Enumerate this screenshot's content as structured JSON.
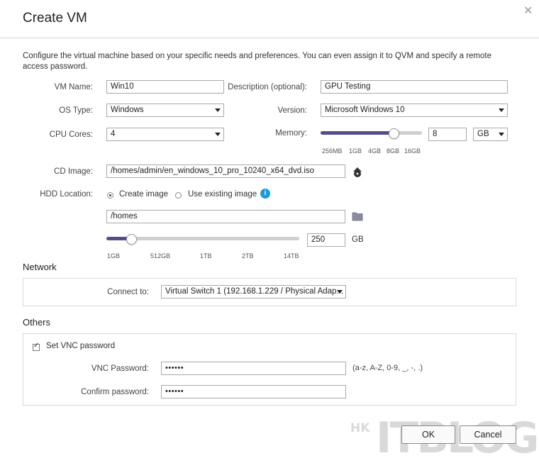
{
  "dialog": {
    "title": "Create VM",
    "description": "Configure the virtual machine based on your specific needs and preferences. You can even assign it to QVM and specify a remote access password."
  },
  "form": {
    "vm_name_label": "VM Name:",
    "vm_name_value": "Win10",
    "description_label": "Description (optional):",
    "description_value": "GPU Testing",
    "os_type_label": "OS Type:",
    "os_type_value": "Windows",
    "version_label": "Version:",
    "version_value": "Microsoft Windows 10",
    "cpu_label": "CPU Cores:",
    "cpu_value": "4",
    "memory_label": "Memory:",
    "memory_value": "8",
    "memory_unit": "GB",
    "memory_slider_fraction": 0.72,
    "memory_ticks": [
      "256MB",
      "1GB",
      "4GB",
      "8GB",
      "16GB"
    ],
    "cd_label": "CD Image:",
    "cd_value": "/homes/admin/en_windows_10_pro_10240_x64_dvd.iso",
    "hdd_label": "HDD Location:",
    "create_image_label": "Create image",
    "use_existing_label": "Use existing image",
    "hdd_path_value": "/homes",
    "hdd_size_value": "250",
    "hdd_size_unit": "GB",
    "hdd_slider_fraction": 0.13,
    "hdd_ticks": [
      "1GB",
      "512GB",
      "1TB",
      "2TB",
      "14TB"
    ]
  },
  "network": {
    "section_title": "Network",
    "connect_label": "Connect to:",
    "connect_value": "Virtual Switch 1 (192.168.1.229 / Physical Adap..."
  },
  "others": {
    "section_title": "Others",
    "vnc_checkbox_label": "Set VNC password",
    "vnc_password_label": "VNC Password:",
    "vnc_password_value": "••••••",
    "vnc_hint": "(a-z, A-Z, 0-9, _, -, .)",
    "confirm_label": "Confirm password:",
    "confirm_value": "••••••"
  },
  "buttons": {
    "ok": "OK",
    "cancel": "Cancel"
  },
  "watermark": {
    "small": "HK",
    "big": "ITBLOG"
  },
  "colors": {
    "slider_fill": "#5a4b8b",
    "info_icon": "#1b9ad6"
  }
}
